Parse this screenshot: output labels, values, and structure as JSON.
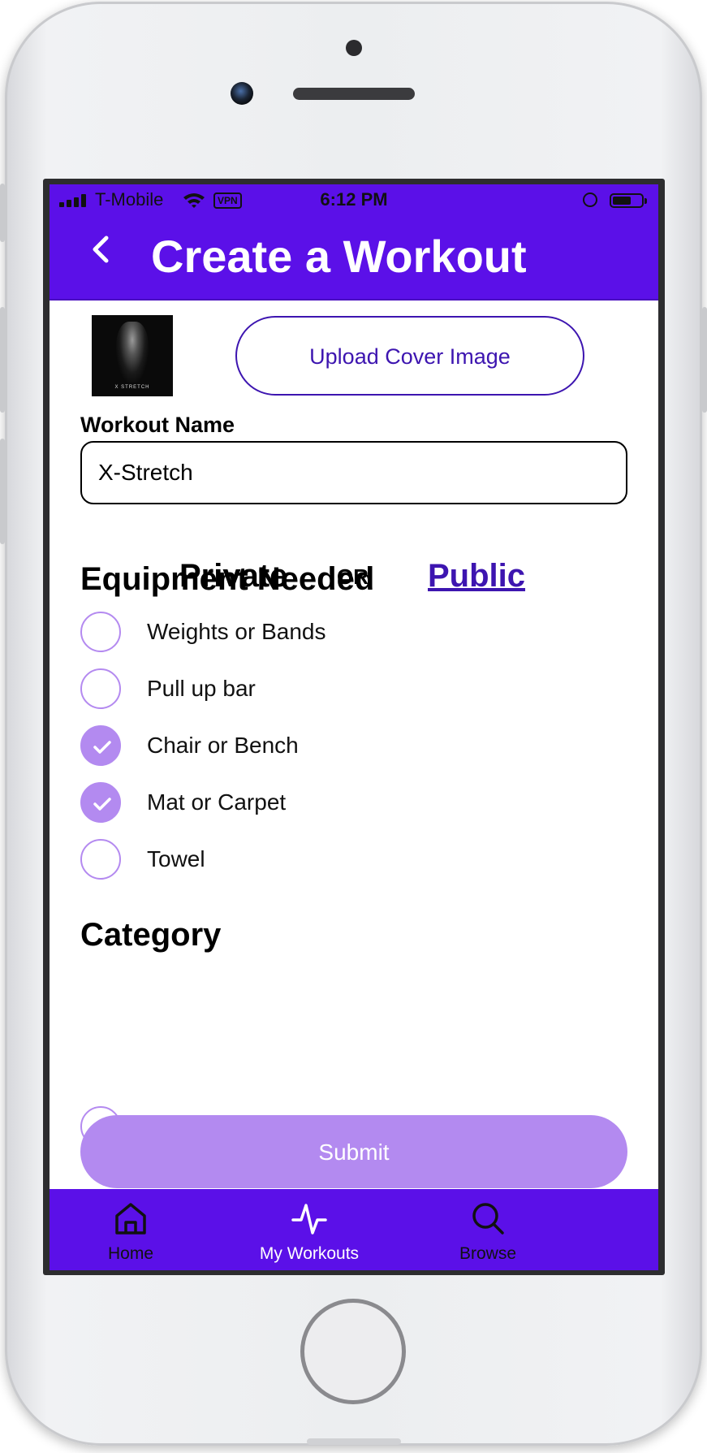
{
  "status_bar": {
    "carrier": "T-Mobile",
    "vpn": "VPN",
    "time": "6:12 PM"
  },
  "header": {
    "title": "Create a Workout"
  },
  "cover": {
    "thumbnail_caption": "X STRETCH",
    "upload_label": "Upload Cover Image"
  },
  "workout_name": {
    "label": "Workout Name",
    "value": "X-Stretch"
  },
  "visibility": {
    "private_label": "Private",
    "or_label": "OR",
    "public_label": "Public",
    "selected": "Public"
  },
  "equipment": {
    "title": "Equipment Needed",
    "items": [
      {
        "label": "Weights or Bands",
        "checked": false
      },
      {
        "label": "Pull up bar",
        "checked": false
      },
      {
        "label": "Chair or Bench",
        "checked": true
      },
      {
        "label": "Mat or Carpet",
        "checked": true
      },
      {
        "label": "Towel",
        "checked": false
      }
    ]
  },
  "category": {
    "title": "Category"
  },
  "submit_label": "Submit",
  "tabbar": {
    "items": [
      {
        "label": "Home",
        "icon": "home-icon",
        "active": false
      },
      {
        "label": "My Workouts",
        "icon": "activity-icon",
        "active": true
      },
      {
        "label": "Browse",
        "icon": "search-icon",
        "active": false
      }
    ]
  },
  "colors": {
    "accent": "#5b10e8",
    "link": "#3d15b0",
    "check": "#b38af0"
  }
}
